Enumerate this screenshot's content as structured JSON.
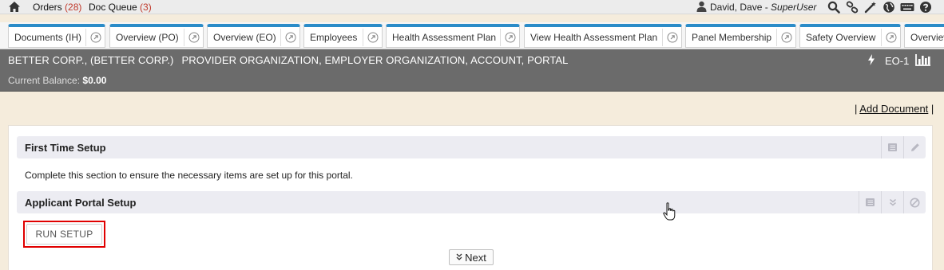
{
  "topbar": {
    "orders_label": "Orders",
    "orders_count": "(28)",
    "docqueue_label": "Doc Queue",
    "docqueue_count": "(3)",
    "user_name": "David, Dave",
    "user_separator": " - ",
    "user_role": "SuperUser",
    "icons": [
      "search-icon",
      "link-icon",
      "magic-wand-icon",
      "globe-icon",
      "keyboard-icon",
      "help-icon"
    ]
  },
  "tabs": [
    {
      "label": "Documents (IH)"
    },
    {
      "label": "Overview (PO)"
    },
    {
      "label": "Overview (EO)"
    },
    {
      "label": "Employees"
    },
    {
      "label": "Health Assessment Plan"
    },
    {
      "label": "View Health Assessment Plan"
    },
    {
      "label": "Panel Membership"
    },
    {
      "label": "Safety Overview"
    },
    {
      "label": "Overview"
    }
  ],
  "org": {
    "name": "BETTER CORP., (BETTER CORP.)",
    "types": "PROVIDER ORGANIZATION, EMPLOYER ORGANIZATION, ACCOUNT, PORTAL",
    "balance_label": "Current Balance:",
    "balance_value": "$0.00",
    "code": "EO-1"
  },
  "actions": {
    "sep_left": "|",
    "add_document": "Add Document",
    "sep_right": "|"
  },
  "first_setup": {
    "title": "First Time Setup",
    "description": "Complete this section to ensure the necessary items are set up for this portal."
  },
  "applicant_setup": {
    "title": "Applicant Portal Setup",
    "run_button": "RUN SETUP"
  },
  "pager": {
    "next_label": "Next"
  },
  "colors": {
    "tab_accent": "#2b8cc8",
    "header_bg": "#6b6b6b",
    "count_red": "#c0392b",
    "highlight_red": "#e00000",
    "page_bg": "#f5ecdc"
  }
}
